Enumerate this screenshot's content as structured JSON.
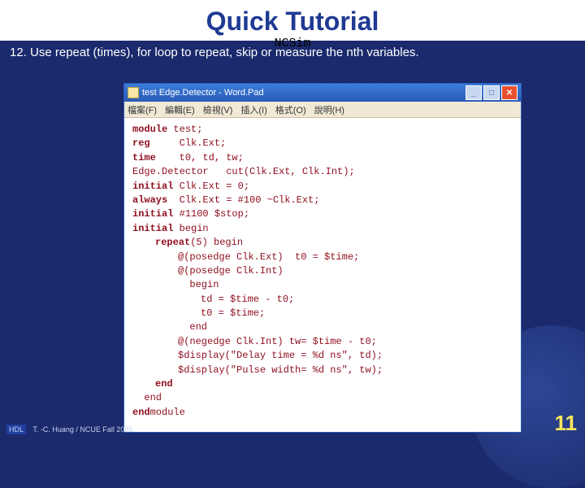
{
  "slide": {
    "title": "Quick Tutorial",
    "subtitle": "NCSim",
    "step": "12. Use repeat (times), for loop to repeat, skip or measure the nth variables."
  },
  "window": {
    "title": "test Edge.Detector - Word.Pad",
    "menus": [
      "檔案(F)",
      "編輯(E)",
      "檢視(V)",
      "插入(I)",
      "格式(O)",
      "說明(H)"
    ]
  },
  "code": [
    {
      "i": 0,
      "t": "module test;"
    },
    {
      "i": 0,
      "t": "reg     Clk.Ext;"
    },
    {
      "i": 0,
      "t": "time    t0, td, tw;"
    },
    {
      "i": 0,
      "t": "Edge.Detector   cut(Clk.Ext, Clk.Int);"
    },
    {
      "i": 0,
      "t": "initial Clk.Ext = 0;"
    },
    {
      "i": 0,
      "t": "always  Clk.Ext = #100 ~Clk.Ext;"
    },
    {
      "i": 0,
      "t": "initial #1100 $stop;"
    },
    {
      "i": 0,
      "t": "initial begin"
    },
    {
      "i": 1,
      "t": "repeat(5) begin"
    },
    {
      "i": 2,
      "t": "@(posedge Clk.Ext)  t0 = $time;"
    },
    {
      "i": 2,
      "t": "@(posedge Clk.Int)"
    },
    {
      "i": 2,
      "t": "  begin"
    },
    {
      "i": 3,
      "t": "td = $time - t0;"
    },
    {
      "i": 3,
      "t": "t0 = $time;"
    },
    {
      "i": 2,
      "t": "  end"
    },
    {
      "i": 2,
      "t": "@(negedge Clk.Int) tw= $time - t0;"
    },
    {
      "i": 2,
      "t": "$display(\"Delay time = %d ns\", td);"
    },
    {
      "i": 2,
      "t": "$display(\"Pulse width= %d ns\", tw);"
    },
    {
      "i": 1,
      "t": "end"
    },
    {
      "i": 0,
      "t": "  end"
    },
    {
      "i": 0,
      "t": "endmodule"
    }
  ],
  "footer": {
    "hdl": "HDL",
    "credit": "T. -C. Huang / NCUE  Fall 2005"
  },
  "page": "11"
}
